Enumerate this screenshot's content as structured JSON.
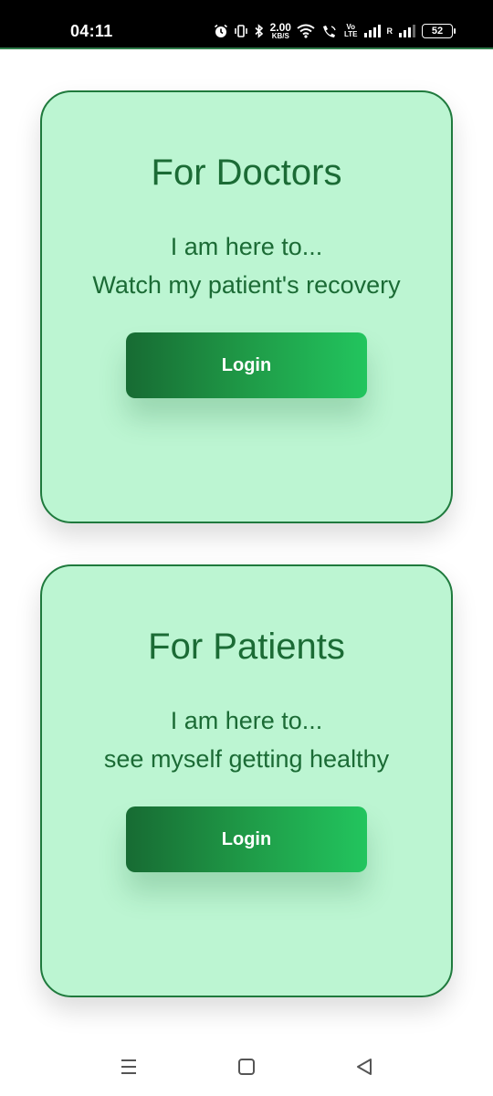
{
  "status_bar": {
    "time": "04:11",
    "net_speed_value": "2.00",
    "net_speed_unit": "KB/S",
    "volte_top": "Vo",
    "volte_bottom": "LTE",
    "roaming": "R",
    "battery_level": "52"
  },
  "cards": [
    {
      "title": "For Doctors",
      "line1": "I am here to...",
      "line2": "Watch my patient's recovery",
      "button_label": "Login"
    },
    {
      "title": "For Patients",
      "line1": "I am here to...",
      "line2": "see myself getting healthy",
      "button_label": "Login"
    }
  ],
  "nav": {
    "recent_icon": "recent-apps-icon",
    "home_icon": "home-icon",
    "back_icon": "back-icon"
  },
  "colors": {
    "card_background": "#bcf5d2",
    "card_border": "#1f7a3d",
    "text_green": "#1b6b35",
    "button_gradient_start": "#176b33",
    "button_gradient_end": "#22c55e"
  }
}
